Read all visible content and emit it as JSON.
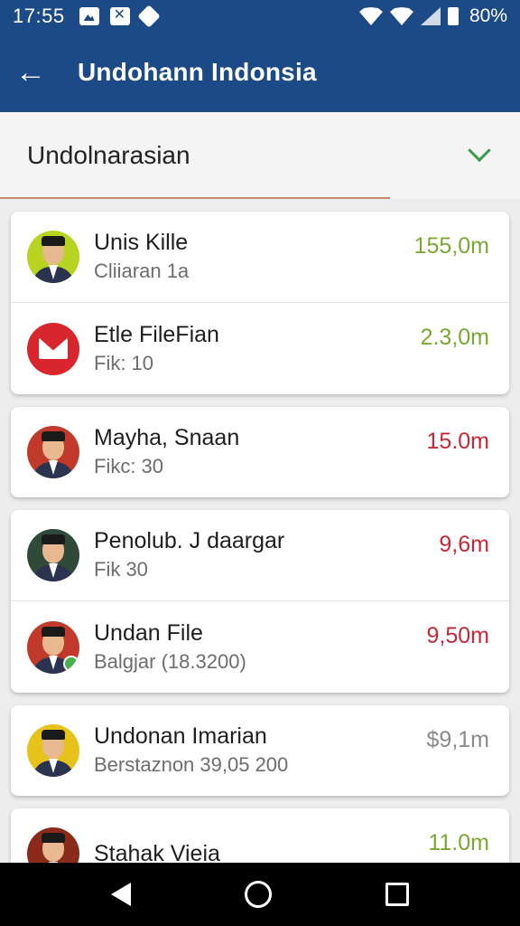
{
  "status_bar": {
    "time": "17:55",
    "battery": "80%",
    "icons": [
      "photo-icon",
      "x-icon",
      "diamond-icon",
      "wifi-icon",
      "signal-icon",
      "battery-icon"
    ]
  },
  "app_bar": {
    "title": "Undohann Indonsia",
    "back_icon": "arrow-left-icon"
  },
  "dropdown": {
    "label": "Undolnarasian",
    "chevron_color": "#3a9a4a"
  },
  "colors": {
    "primary": "#1c4a86",
    "green_amount": "#7aa832",
    "red_amount": "#c62838",
    "gray_amount": "#8a8a8a"
  },
  "list": [
    {
      "rows": [
        {
          "title": "Unis Kille",
          "subtitle": "Cliiaran 1a",
          "amount": "155,0m",
          "amount_color": "green",
          "icon": "avatar-man-icon",
          "avatar_bg": "#b8d420"
        },
        {
          "title": "Etle FileFian",
          "subtitle": "Fik: 10",
          "amount": "2.3,0m",
          "amount_color": "green",
          "icon": "mail-icon"
        }
      ]
    },
    {
      "rows": [
        {
          "title": "Mayha, Snaan",
          "subtitle": "Fikc: 30",
          "amount": "15.0m",
          "amount_color": "red",
          "icon": "avatar-man-icon",
          "avatar_bg": "#c0392b"
        }
      ]
    },
    {
      "rows": [
        {
          "title": "Penolub. J daargar",
          "subtitle": "Fik 30",
          "amount": "9,6m",
          "amount_color": "red",
          "icon": "avatar-man-icon",
          "avatar_bg": "#2f4a3a"
        },
        {
          "title": "Undan File",
          "subtitle": "Balgjar (18.3200)",
          "amount": "9,50m",
          "amount_color": "red",
          "icon": "avatar-man-icon",
          "avatar_bg": "#c0392b",
          "badge": true
        }
      ]
    },
    {
      "rows": [
        {
          "title": "Undonan Imarian",
          "subtitle": "Berstaznon 39,05 200",
          "amount": "$9,1m",
          "amount_color": "gray",
          "icon": "avatar-man-icon",
          "avatar_bg": "#e6c21a"
        }
      ]
    },
    {
      "rows": [
        {
          "title": "Stahak Vieia",
          "subtitle": "",
          "amount": "11.0m",
          "amount_color": "green",
          "icon": "avatar-man-icon",
          "avatar_bg": "#8a2a1a"
        }
      ]
    }
  ],
  "nav_bar": {
    "icons": [
      "nav-back-icon",
      "nav-home-icon",
      "nav-recent-icon"
    ]
  }
}
